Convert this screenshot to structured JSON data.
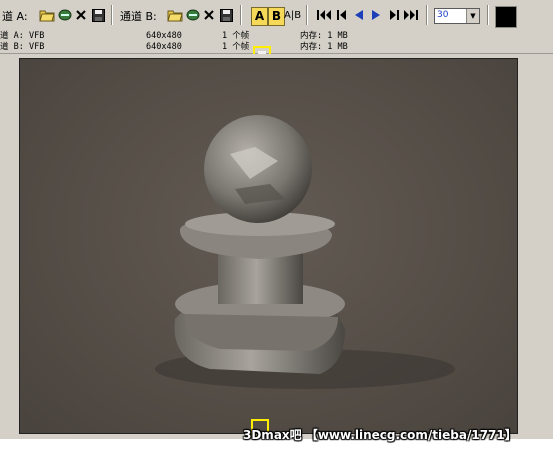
{
  "toolbar": {
    "channel_a_label": "道 A:",
    "channel_b_label": "通道 B:",
    "btn_a": "A",
    "btn_b": "B",
    "btn_ab": "A|B",
    "frame_value": "30"
  },
  "info_rows": [
    {
      "channel": "道 A: VFB",
      "resolution": "640x480",
      "frames": "1 个帧",
      "memory": "内存: 1 MB"
    },
    {
      "channel": "道 B: VFB",
      "resolution": "640x480",
      "frames": "1 个帧",
      "memory": "内存: 1 MB"
    }
  ],
  "watermark": "3Dmax吧 【www.linecg.com/tieba/1771】",
  "colors": {
    "toolbar_bg": "#d4d0c8",
    "render_bg": "#554e47",
    "highlight": "#ffee00",
    "ab_active": "#f7d95a",
    "swatch": "#000000"
  }
}
